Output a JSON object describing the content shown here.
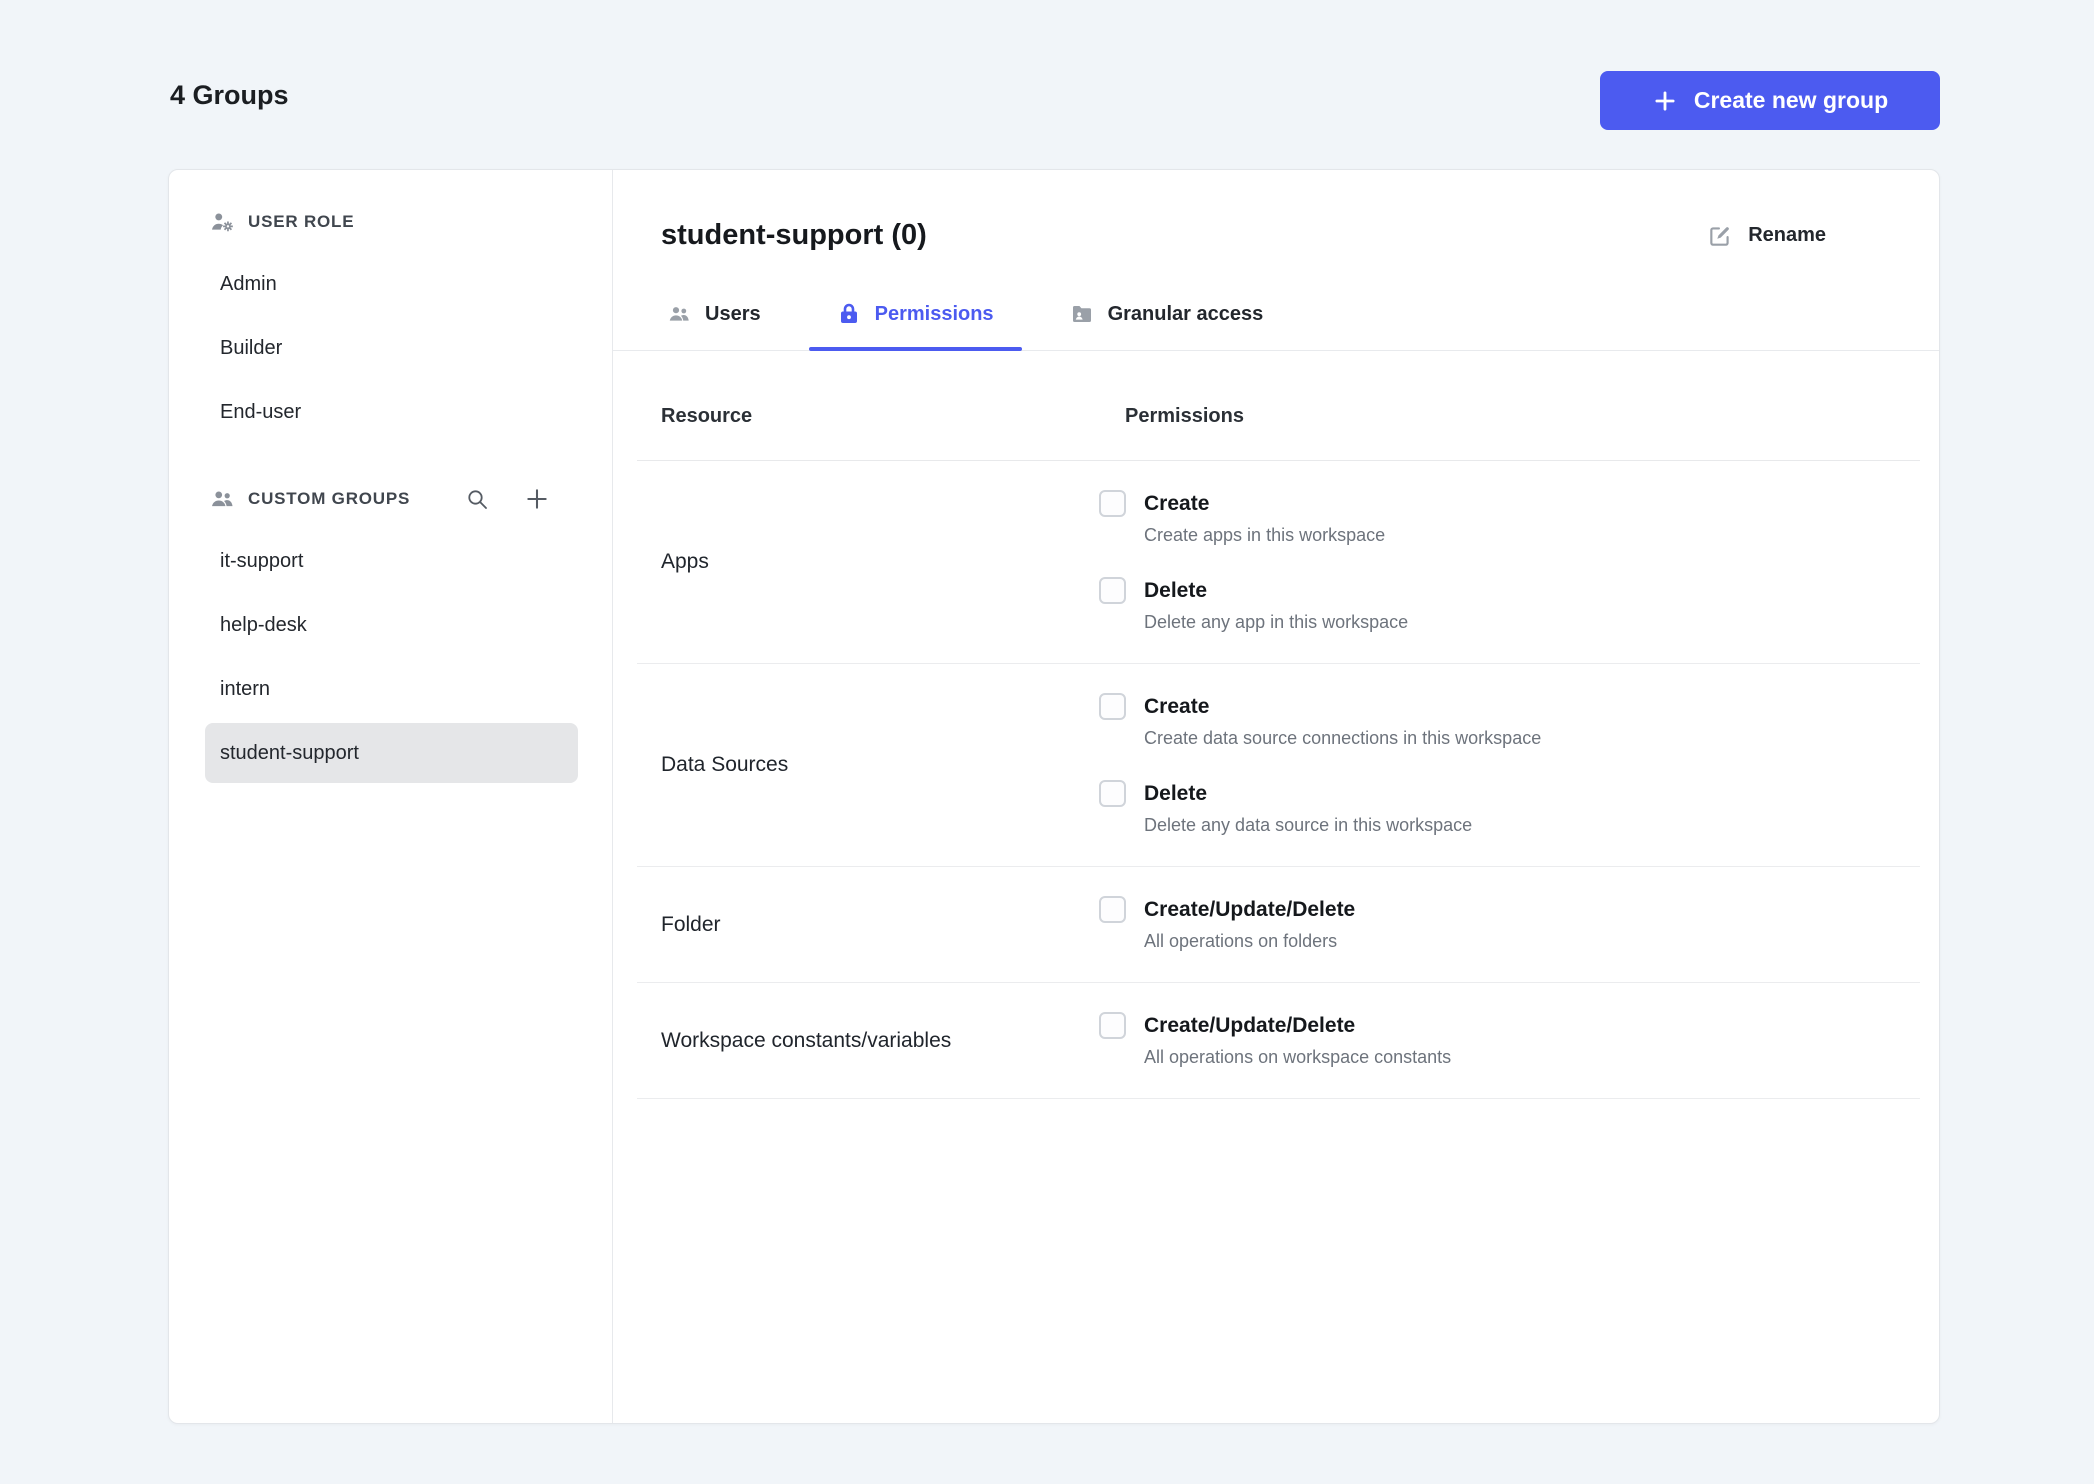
{
  "page": {
    "title": "4 Groups",
    "create_button_label": "Create new group"
  },
  "sidebar": {
    "user_role": {
      "header": "USER ROLE",
      "items": [
        {
          "label": "Admin"
        },
        {
          "label": "Builder"
        },
        {
          "label": "End-user"
        }
      ]
    },
    "custom_groups": {
      "header": "CUSTOM GROUPS",
      "items": [
        {
          "label": "it-support",
          "selected": false
        },
        {
          "label": "help-desk",
          "selected": false
        },
        {
          "label": "intern",
          "selected": false
        },
        {
          "label": "student-support",
          "selected": true
        }
      ]
    }
  },
  "main": {
    "title": "student-support (0)",
    "rename_label": "Rename",
    "tabs": [
      {
        "label": "Users",
        "active": false
      },
      {
        "label": "Permissions",
        "active": true
      },
      {
        "label": "Granular access",
        "active": false
      }
    ],
    "table": {
      "headers": {
        "resource": "Resource",
        "permissions": "Permissions"
      },
      "rows": [
        {
          "resource": "Apps",
          "permissions": [
            {
              "label": "Create",
              "description": "Create apps in this workspace",
              "checked": false
            },
            {
              "label": "Delete",
              "description": "Delete any app in this workspace",
              "checked": false
            }
          ]
        },
        {
          "resource": "Data Sources",
          "permissions": [
            {
              "label": "Create",
              "description": "Create data source connections in this workspace",
              "checked": false
            },
            {
              "label": "Delete",
              "description": "Delete any data source in this workspace",
              "checked": false
            }
          ]
        },
        {
          "resource": "Folder",
          "permissions": [
            {
              "label": "Create/Update/Delete",
              "description": "All operations on folders",
              "checked": false
            }
          ]
        },
        {
          "resource": "Workspace constants/variables",
          "permissions": [
            {
              "label": "Create/Update/Delete",
              "description": "All operations on workspace constants",
              "checked": false
            }
          ]
        }
      ]
    }
  },
  "icons": {
    "user_role_header": "user-gear-icon",
    "custom_groups_header": "users-icon",
    "search": "search-icon",
    "add_group": "plus-icon",
    "users_tab": "users-icon",
    "permissions_tab": "lock-icon",
    "granular_access_tab": "folder-user-icon",
    "rename": "edit-pencil-icon",
    "create_button": "plus-icon"
  },
  "colors": {
    "accent": "#4c5bf0",
    "page_background": "#f1f5f9",
    "selected_item_background": "#e5e6e8"
  }
}
